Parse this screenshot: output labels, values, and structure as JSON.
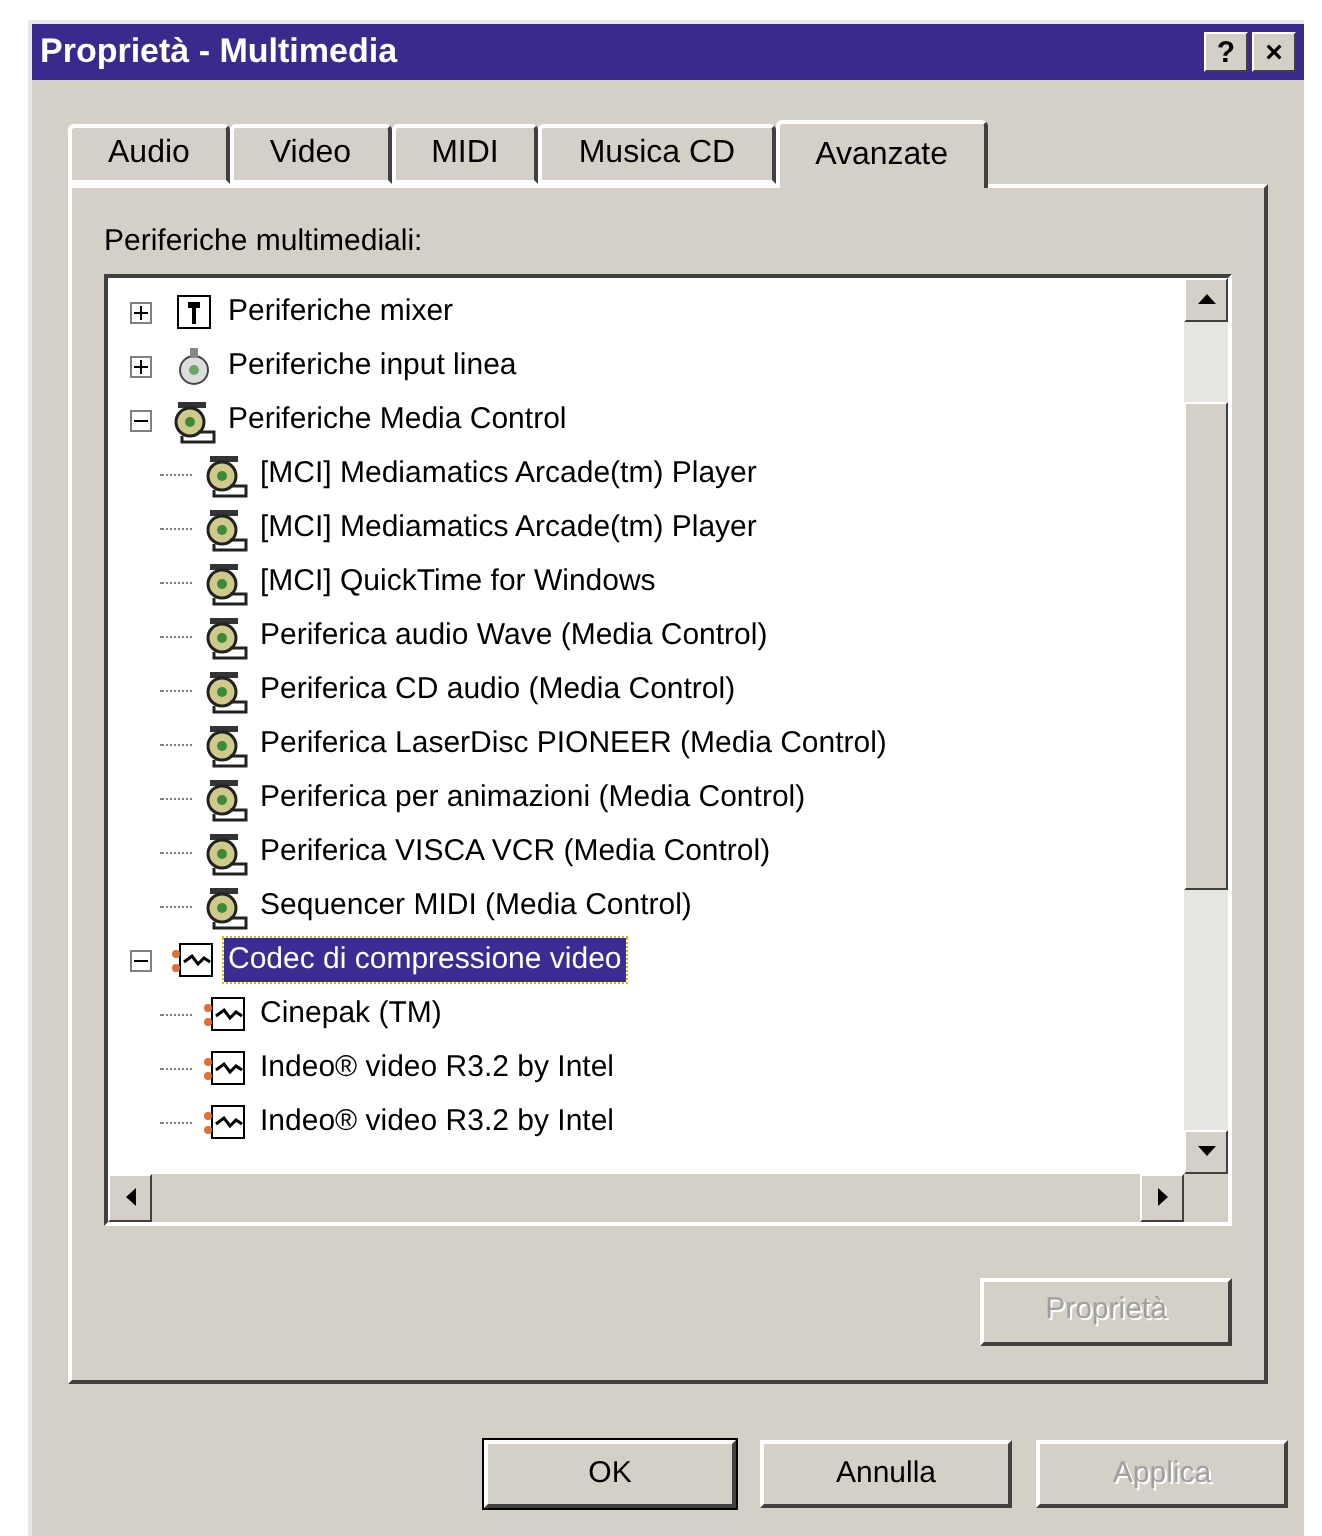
{
  "window": {
    "title": "Proprietà - Multimedia",
    "buttons": [
      "?",
      "×"
    ]
  },
  "tabs": [
    {
      "label": "Audio",
      "selected": false
    },
    {
      "label": "Video",
      "selected": false
    },
    {
      "label": "MIDI",
      "selected": false
    },
    {
      "label": "Musica CD",
      "selected": false
    },
    {
      "label": "Avanzate",
      "selected": true
    }
  ],
  "tree_label": "Periferiche multimediali:",
  "tree": [
    {
      "label": "Periferiche mixer",
      "kind": "mixer",
      "expanded": false,
      "selected": false
    },
    {
      "label": "Periferiche input linea",
      "kind": "line",
      "expanded": false,
      "selected": false
    },
    {
      "label": "Periferiche Media Control",
      "kind": "mci",
      "expanded": true,
      "selected": false,
      "children": [
        {
          "label": "[MCI] Mediamatics Arcade(tm) Player",
          "kind": "mci",
          "selected": false
        },
        {
          "label": "[MCI] Mediamatics Arcade(tm) Player",
          "kind": "mci",
          "selected": false
        },
        {
          "label": "[MCI] QuickTime for Windows",
          "kind": "mci",
          "selected": false
        },
        {
          "label": "Periferica audio Wave (Media Control)",
          "kind": "mci",
          "selected": false
        },
        {
          "label": "Periferica CD audio (Media Control)",
          "kind": "mci",
          "selected": false
        },
        {
          "label": "Periferica LaserDisc PIONEER (Media Control)",
          "kind": "mci",
          "selected": false
        },
        {
          "label": "Periferica per animazioni (Media Control)",
          "kind": "mci",
          "selected": false
        },
        {
          "label": "Periferica VISCA VCR (Media Control)",
          "kind": "mci",
          "selected": false
        },
        {
          "label": "Sequencer MIDI (Media Control)",
          "kind": "mci",
          "selected": false
        }
      ]
    },
    {
      "label": "Codec di compressione video",
      "kind": "codec",
      "expanded": true,
      "selected": true,
      "children": [
        {
          "label": "Cinepak (TM)",
          "kind": "codec",
          "selected": false
        },
        {
          "label": "Indeo® video R3.2 by Intel",
          "kind": "codec",
          "selected": false
        },
        {
          "label": "Indeo® video R3.2 by Intel",
          "kind": "codec",
          "selected": false
        }
      ]
    }
  ],
  "properties_button": {
    "label": "Proprietà",
    "disabled": true
  },
  "footer_buttons": [
    {
      "label": "OK",
      "disabled": false,
      "default": true
    },
    {
      "label": "Annulla",
      "disabled": false,
      "default": false
    },
    {
      "label": "Applica",
      "disabled": true,
      "default": false
    }
  ]
}
